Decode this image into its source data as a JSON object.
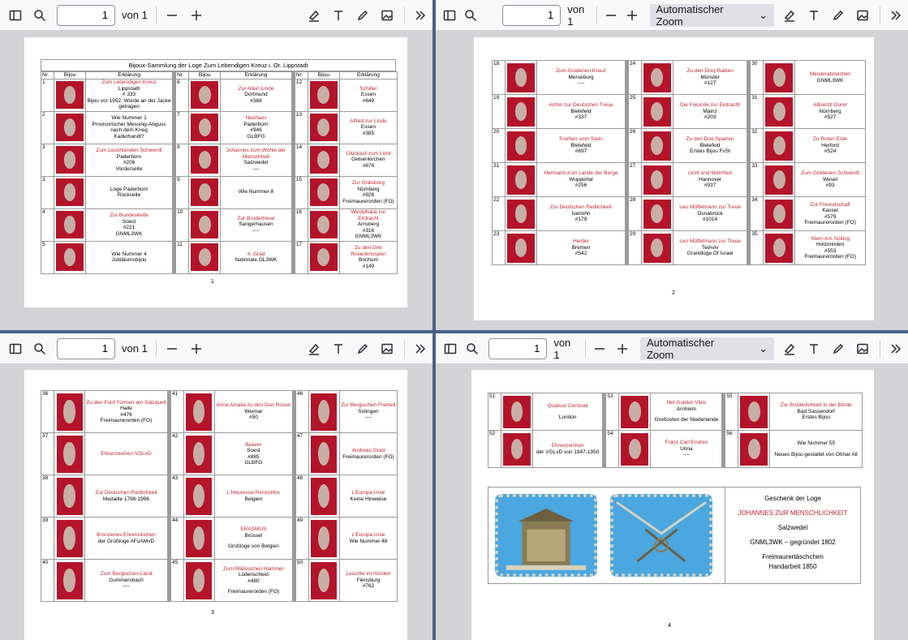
{
  "toolbar": {
    "page_value": "1",
    "of_label": "von 1",
    "zoom_label": "Automatischer Zoom"
  },
  "pages": {
    "p1": {
      "title": "Bijoux-Sammlung der Loge Zum Lebendigen Kreuz i. Or. Lippstadt",
      "head_nr": "Nr.",
      "head_bijou": "Bijou",
      "head_erkl": "Erklärung",
      "number": "1",
      "cols": [
        [
          {
            "nr": "1",
            "name": "Zum Lebendigen Kreuz",
            "lines": [
              "Lippstadt",
              "# 333",
              "Bijou vor 1952. Wurde an der Jacke getragen"
            ]
          },
          {
            "nr": "2",
            "name": "",
            "lines": [
              "Wie Nummer 1",
              "Provisorischer Messing-Abguss nach dem Krieg",
              "Kaderhandt?"
            ]
          },
          {
            "nr": "3",
            "name": "Zum Leuchtenden Schwerdt",
            "lines": [
              "Paderborn",
              "#206",
              "Vorderseite"
            ]
          },
          {
            "nr": "3",
            "name": "",
            "lines": [
              "Loge Paderborn",
              "Rückseite"
            ]
          },
          {
            "nr": "4",
            "name": "Zur Bundeskette",
            "lines": [
              "Soest",
              "#221",
              "GNML3WK"
            ]
          },
          {
            "nr": "5",
            "name": "",
            "lines": [
              "Wie Nummer 4",
              "Jubiläumsbijou"
            ]
          }
        ],
        [
          {
            "nr": "6",
            "name": "Zur Alten Linde",
            "lines": [
              "Dortmund",
              "#368"
            ]
          },
          {
            "nr": "7",
            "name": "Neuhaus",
            "lines": [
              "Paderborn",
              "#946",
              "GLBFG"
            ]
          },
          {
            "nr": "8",
            "name": "Johannes zum Wohle der Menschheit",
            "lines": [
              "Salzwedel",
              "----"
            ]
          },
          {
            "nr": "9",
            "name": "",
            "lines": [
              "Wie Nummer 8"
            ]
          },
          {
            "nr": "10",
            "name": "Zur Brudertreue",
            "lines": [
              "Sangerhausen",
              "----"
            ]
          },
          {
            "nr": "11",
            "name": "4. Grad",
            "lines": [
              "Nationale GL3WK"
            ]
          }
        ],
        [
          {
            "nr": "12",
            "name": "Schiller",
            "lines": [
              "Essen",
              "#649"
            ]
          },
          {
            "nr": "13",
            "name": "Alfred zur Linde",
            "lines": [
              "Essen",
              "#385"
            ]
          },
          {
            "nr": "14",
            "name": "Glückauf zum Licht",
            "lines": [
              "Gelsenkirchen",
              "#874"
            ]
          },
          {
            "nr": "15",
            "name": "Zur Gralsburg",
            "lines": [
              "Nürnberg",
              "#926",
              "Freimaurerorden (FO)"
            ]
          },
          {
            "nr": "16",
            "name": "Westphalia zur Eintracht",
            "lines": [
              "Arnsberg",
              "#316",
              "GNML3WK"
            ]
          },
          {
            "nr": "17",
            "name": "Zu den Drei Rosenknospen",
            "lines": [
              "Bochum",
              "#149"
            ]
          }
        ]
      ]
    },
    "p2": {
      "number": "2",
      "cols": [
        [
          {
            "nr": "18",
            "name": "Zum Goldenen Kreuz",
            "lines": [
              "Merseburg",
              "----"
            ]
          },
          {
            "nr": "19",
            "name": "Armin zur Deutschen Treue",
            "lines": [
              "Bielefeld",
              "#337"
            ]
          },
          {
            "nr": "20",
            "name": "Freiherr vom Stein",
            "lines": [
              "Bielefeld",
              "#697"
            ]
          },
          {
            "nr": "21",
            "name": "Hermann zum Lande der Berge",
            "lines": [
              "Wuppertal",
              "#256"
            ]
          },
          {
            "nr": "22",
            "name": "Zur Deutschen Redlichkeit",
            "lines": [
              "Iserlohn",
              "#179"
            ]
          },
          {
            "nr": "23",
            "name": "Herder",
            "lines": [
              "Bremen",
              "#542"
            ]
          }
        ],
        [
          {
            "nr": "24",
            "name": "Zu den Drey Balken",
            "lines": [
              "Münster",
              "#127"
            ]
          },
          {
            "nr": "25",
            "name": "Die Freunde zur Eintracht",
            "lines": [
              "Mainz",
              "#203"
            ]
          },
          {
            "nr": "26",
            "name": "Zu den Drei Sparren",
            "lines": [
              "Bielefeld",
              "Erstes Bijou FvSt"
            ]
          },
          {
            "nr": "27",
            "name": "Licht und Wahrheit",
            "lines": [
              "Hannover",
              "#937"
            ]
          },
          {
            "nr": "28",
            "name": "Leo Müffelmann zur Treue",
            "lines": [
              "Osnabrück",
              "#1014"
            ]
          },
          {
            "nr": "29",
            "name": "Leo Müffelmann zur Treue",
            "lines": [
              "TelAviv",
              "Grandloge Of Israel"
            ]
          }
        ],
        [
          {
            "nr": "30",
            "name": "Meisterabzeichen",
            "lines": [
              "GNML3WK"
            ]
          },
          {
            "nr": "31",
            "name": "Albrecht Dürer",
            "lines": [
              "Nürnberg",
              "#527"
            ]
          },
          {
            "nr": "32",
            "name": "Zu Roten Erde",
            "lines": [
              "Herford",
              "#524"
            ]
          },
          {
            "nr": "33",
            "name": "Zum Goldenen Schwerdt",
            "lines": [
              "Wesel",
              "#93"
            ]
          },
          {
            "nr": "34",
            "name": "Zur Freundschaft",
            "lines": [
              "Kassel",
              "#579",
              "Freimaurerorden (FO)"
            ]
          },
          {
            "nr": "35",
            "name": "Stern Am Solling",
            "lines": [
              "Holzminden",
              "#553",
              "Freimaurerorden (FO)"
            ]
          }
        ]
      ]
    },
    "p3": {
      "number": "3",
      "cols": [
        [
          {
            "nr": "36",
            "name": "Zu den Fünf Türmen am Salzquell",
            "lines": [
              "Halle",
              "#476",
              "Freimaurerorden (FO)"
            ]
          },
          {
            "nr": "37",
            "name": "Ehrenzeichen VGLvD",
            "lines": []
          },
          {
            "nr": "38",
            "name": "Zur Deutschen Redlichkeit",
            "lines": [
              "Medaille 1796-1996"
            ]
          },
          {
            "nr": "39",
            "name": "Bronzenes Ehrenzeichen",
            "lines": [
              "der Großloge AFuAMvD"
            ]
          },
          {
            "nr": "40",
            "name": "Zum Bergischen Land",
            "lines": [
              "Gummersbach",
              "----"
            ]
          }
        ],
        [
          {
            "nr": "41",
            "name": "Anna Amalia zu den Drei Rosen",
            "lines": [
              "Weimar",
              "#50"
            ]
          },
          {
            "nr": "42",
            "name": "Beaver",
            "lines": [
              "Soest",
              "#885",
              "GLBFG"
            ]
          },
          {
            "nr": "43",
            "name": "L'Heureuse Rencontre",
            "lines": [
              "Belgien"
            ]
          },
          {
            "nr": "44",
            "name": "ERASMUS",
            "lines": [
              "Brüssel",
              "",
              "Großloge von Belgien"
            ]
          },
          {
            "nr": "45",
            "name": "Zum Märkischen Hammer",
            "lines": [
              "Lüdenscheid",
              "#480",
              "",
              "Freimaurerorden (FO)"
            ]
          }
        ],
        [
          {
            "nr": "46",
            "name": "Zur Bergischen Freiheit",
            "lines": [
              "Solingen",
              "----"
            ]
          },
          {
            "nr": "47",
            "name": "Andreas Grad",
            "lines": [
              "Freimaurerorden (FO)"
            ]
          },
          {
            "nr": "48",
            "name": "L'Europe Unie",
            "lines": [
              "Keine Hinweise"
            ]
          },
          {
            "nr": "49",
            "name": "L'Europe Unie",
            "lines": [
              "Wie Nummer 48"
            ]
          },
          {
            "nr": "50",
            "name": "Leuchte im Norden",
            "lines": [
              "Flensburg",
              "#762"
            ]
          }
        ]
      ]
    },
    "p4": {
      "number": "4",
      "cols": [
        [
          {
            "nr": "51",
            "name": "Quatuor Coronati",
            "lines": [
              "",
              "London"
            ]
          },
          {
            "nr": "52",
            "name": "Ehrenzeichen",
            "lines": [
              "der VGLvD von 1947-1950"
            ]
          }
        ],
        [
          {
            "nr": "53",
            "name": "Het Gulden Vlies",
            "lines": [
              "Arnheim",
              "",
              "Großosten der Niederlande"
            ]
          },
          {
            "nr": "54",
            "name": "Franz Carl Endres",
            "lines": [
              "Unna",
              "----"
            ]
          }
        ],
        [
          {
            "nr": "55",
            "name": "Zur Brüderlichkeit in der Börde",
            "lines": [
              "Bad Sassendorf",
              "Erstes Bijou"
            ]
          },
          {
            "nr": "56",
            "name": "",
            "lines": [
              "Wie Nummer 55",
              "",
              "Neues Bijou gestaltet von Otmar Alt"
            ]
          }
        ]
      ],
      "gift": {
        "l1": "Geschenk der Loge",
        "l2": "JOHANNES ZUR MENSCHLICHKEIT",
        "l3": "Salzwedel",
        "l4": "GNML3WK – gegründet 1802",
        "l5": "Freimaurertäschchen",
        "l6": "Handarbeit 1850"
      }
    }
  }
}
